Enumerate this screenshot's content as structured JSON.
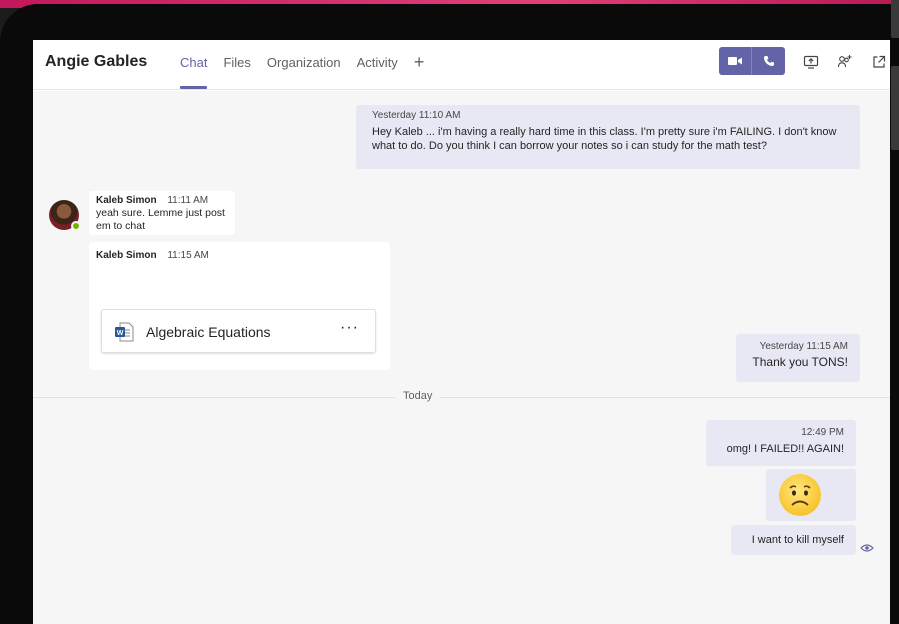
{
  "header": {
    "contact_name": "Angie Gables",
    "tabs": [
      {
        "label": "Chat",
        "active": true
      },
      {
        "label": "Files",
        "active": false
      },
      {
        "label": "Organization",
        "active": false
      },
      {
        "label": "Activity",
        "active": false
      }
    ],
    "add_tab_label": "+",
    "icons": [
      "video-call-icon",
      "audio-call-icon",
      "share-screen-icon",
      "add-people-icon",
      "pop-out-icon"
    ],
    "accent_color": "#6264a7"
  },
  "messages": {
    "m1": {
      "timestamp": "Yesterday   11:10 AM",
      "text": "Hey Kaleb ... i'm having a really hard time in this class. I'm pretty sure i'm FAILING. I don't know what to do. Do you think I can borrow your notes so i can study for the math test?"
    },
    "m2": {
      "sender": "Kaleb Simon",
      "time": "11:11 AM",
      "text": "yeah sure. Lemme just post em to chat"
    },
    "m3": {
      "sender": "Kaleb Simon",
      "time": "11:15 AM",
      "file_name": "Algebraic Equations",
      "more_label": "···"
    },
    "m4": {
      "timestamp": "Yesterday   11:15 AM",
      "text": "Thank you TONS!"
    },
    "divider_label": "Today",
    "m5": {
      "time": "12:49 PM",
      "text": "omg! I FAILED!! AGAIN!"
    },
    "m6": {
      "emoji": "worried-face"
    },
    "m7": {
      "text": "I want to kill myself"
    }
  }
}
